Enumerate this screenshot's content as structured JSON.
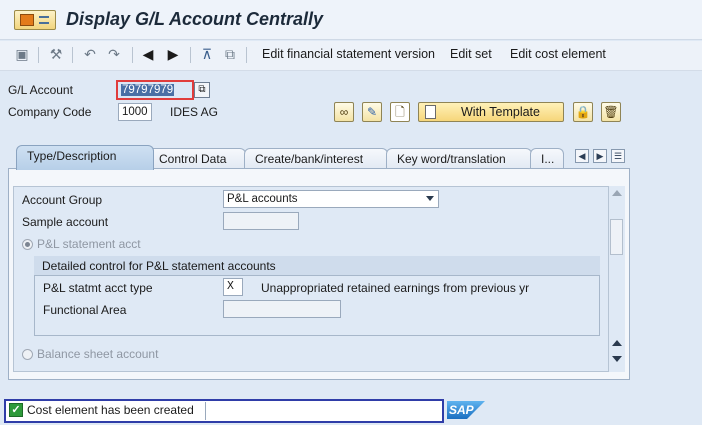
{
  "title": "Display G/L Account Centrally",
  "toolbar": {
    "items": [
      {
        "label": "Edit financial statement version"
      },
      {
        "label": "Edit set"
      },
      {
        "label": "Edit cost element"
      }
    ]
  },
  "header": {
    "gl_account_label": "G/L Account",
    "gl_account_value": "79797979",
    "company_code_label": "Company Code",
    "company_code_value": "1000",
    "company_name": "IDES AG",
    "template_button_label": "With Template"
  },
  "tabs": [
    {
      "label": "Type/Description",
      "active": true
    },
    {
      "label": "Control Data"
    },
    {
      "label": "Create/bank/interest"
    },
    {
      "label": "Key word/translation"
    },
    {
      "label": "I..."
    }
  ],
  "form": {
    "account_group_label": "Account Group",
    "account_group_value": "P&L accounts",
    "sample_account_label": "Sample account",
    "sample_account_value": "",
    "pl_radio_label": "P&L statement acct",
    "group_title": "Detailed control for P&L statement accounts",
    "pl_type_label": "P&L statmt acct type",
    "pl_type_value": "X",
    "pl_type_description": "Unappropriated retained earnings from previous yr",
    "functional_area_label": "Functional Area",
    "functional_area_value": "",
    "bs_radio_label": "Balance sheet account"
  },
  "status": {
    "message": "Cost element has been created",
    "logo_text": "SAP"
  },
  "colors": {
    "accent": "#2f3da8",
    "success": "#2e9a3a",
    "highlight_border": "#e03c3c"
  }
}
